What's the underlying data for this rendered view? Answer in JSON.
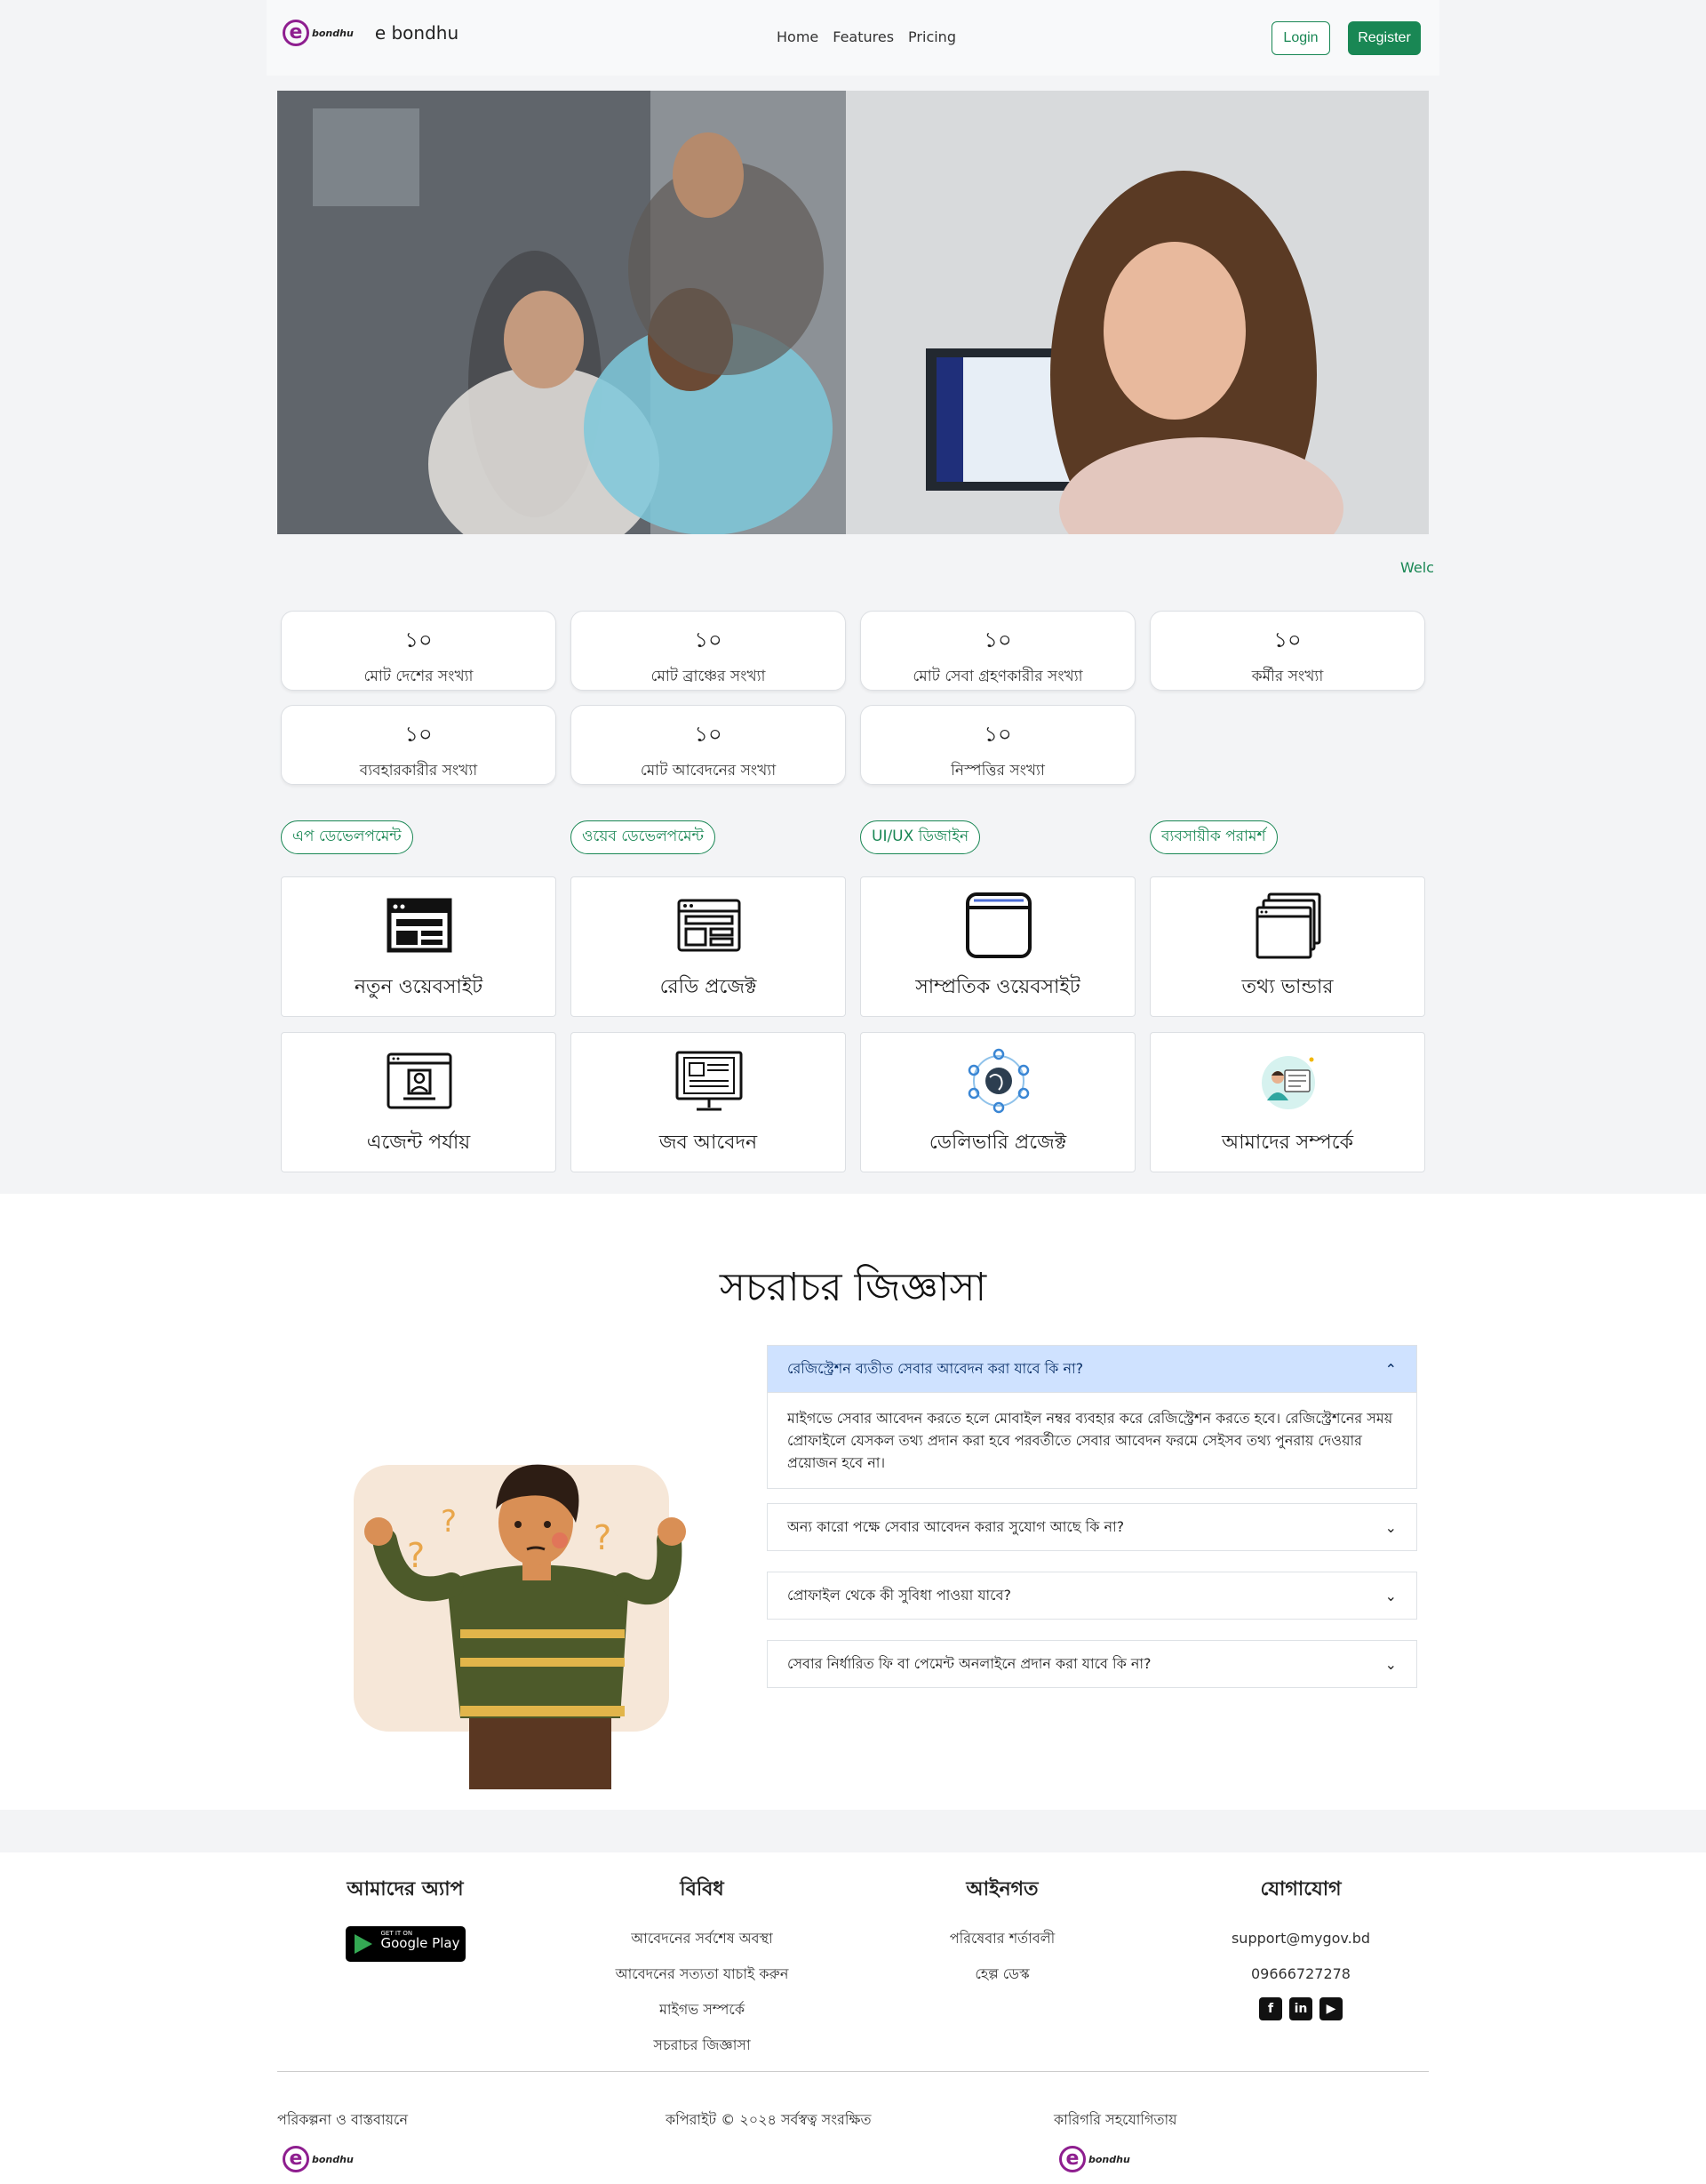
{
  "nav": {
    "brand": "e bondhu",
    "logo_letter": "e",
    "logo_text": "bondhu",
    "menu": [
      "Home",
      "Features",
      "Pricing"
    ],
    "login": "Login",
    "register": "Register"
  },
  "marquee": "Welc",
  "stats": [
    {
      "value": "১০",
      "label": "মোট দেশের সংখ্যা"
    },
    {
      "value": "১০",
      "label": "মোট ব্রাঞ্চের সংখ্যা"
    },
    {
      "value": "১০",
      "label": "মোট সেবা গ্রহণকারীর সংখ্যা"
    },
    {
      "value": "১০",
      "label": "কর্মীর সংখ্যা"
    },
    {
      "value": "১০",
      "label": "ব্যবহারকারীর সংখ্যা"
    },
    {
      "value": "১০",
      "label": "মোট আবেদনের সংখ্যা"
    },
    {
      "value": "১০",
      "label": "নিস্পত্তির সংখ্যা"
    }
  ],
  "categories": [
    "এপ ডেভেলপমেন্ট",
    "ওয়েব ডেভেলপমেন্ট",
    "UI/UX ডিজাইন",
    "ব্যবসায়ীক পরামর্শ"
  ],
  "features": [
    {
      "label": "নতুন ওয়েবসাইট",
      "icon": "website-layout-icon"
    },
    {
      "label": "রেডি প্রজেক্ট",
      "icon": "browser-layout-icon"
    },
    {
      "label": "সাম্প্রতিক ওয়েবসাইট",
      "icon": "browser-window-icon"
    },
    {
      "label": "তথ্য ভান্ডার",
      "icon": "stacked-windows-icon"
    },
    {
      "label": "এজেন্ট পর্যায়",
      "icon": "user-profile-window-icon"
    },
    {
      "label": "জব আবেদন",
      "icon": "monitor-document-icon"
    },
    {
      "label": "ডেলিভারি প্রজেক্ট",
      "icon": "globe-network-icon"
    },
    {
      "label": "আমাদের সম্পর্কে",
      "icon": "person-card-icon"
    }
  ],
  "faq": {
    "title": "সচরাচর জিজ্ঞাসা",
    "items": [
      {
        "q": "রেজিস্ট্রেশন ব্যতীত সেবার আবেদন করা যাবে কি না?",
        "a": "মাইগভে সেবার আবেদন করতে হলে মোবাইল নম্বর ব্যবহার করে রেজিস্ট্রেশন করতে হবে। রেজিস্ট্রেশনের সময় প্রোফাইলে যেসকল তথ্য প্রদান করা হবে পরবর্তীতে সেবার আবেদন ফরমে সেইসব তথ্য পুনরায় দেওয়ার প্রয়োজন হবে না।"
      },
      {
        "q": "অন্য কারো পক্ষে সেবার আবেদন করার সুযোগ আছে কি না?"
      },
      {
        "q": "প্রোফাইল থেকে কী সুবিধা পাওয়া যাবে?"
      },
      {
        "q": "সেবার নির্ধারিত ফি বা পেমেন্ট অনলাইনে প্রদান করা যাবে কি না?"
      }
    ]
  },
  "footer": {
    "app_title": "আমাদের অ্যাপ",
    "gplay_small": "GET IT ON",
    "gplay_big": "Google Play",
    "misc_title": "বিবিধ",
    "misc": [
      "আবেদনের সর্বশেষ অবস্থা",
      "আবেদনের সত্যতা যাচাই করুন",
      "মাইগভ সম্পর্কে",
      "সচরাচর জিজ্ঞাসা"
    ],
    "legal_title": "আইনগত",
    "legal": [
      "পরিষেবার শর্তাবলী",
      "হেল্প ডেস্ক"
    ],
    "contact_title": "যোগাযোগ",
    "email": "support@mygov.bd",
    "phone": "09666727278",
    "planning": "পরিকল্পনা ও বাস্তবায়নে",
    "copyright": "কপিরাইট © ২০২৪ সর্বস্বত্ব সংরক্ষিত",
    "tech": "কারিগরি সহযোগিতায়"
  }
}
